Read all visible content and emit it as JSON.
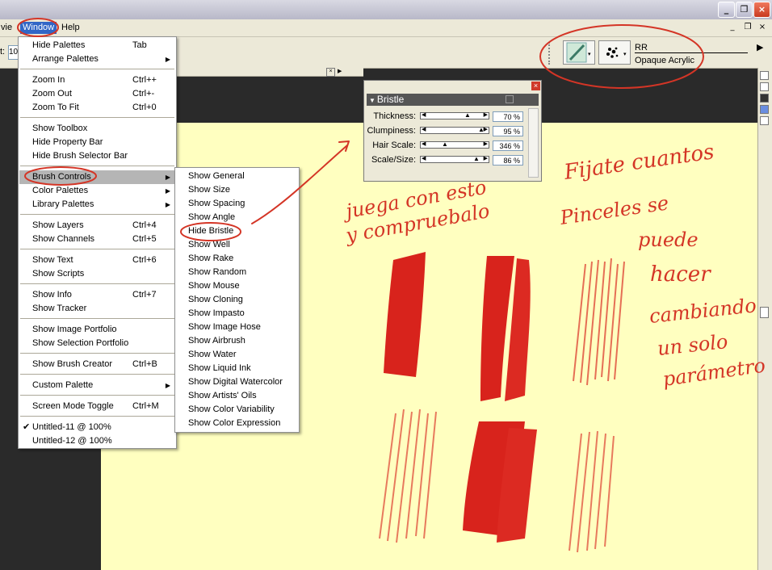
{
  "menubar": {
    "view_partial": "vie",
    "window": "Window",
    "help": "Help",
    "min": "_",
    "restore": "❐",
    "close": "×"
  },
  "propbar": {
    "field_label": "t:",
    "field_value": "10"
  },
  "brush_selector": {
    "category": "RR",
    "variant": "Opaque Acrylic"
  },
  "window_menu": [
    {
      "label": "Hide Palettes",
      "shortcut": "Tab"
    },
    {
      "label": "Arrange Palettes",
      "submenu": true
    },
    {
      "sep": true
    },
    {
      "label": "Zoom In",
      "shortcut": "Ctrl++"
    },
    {
      "label": "Zoom Out",
      "shortcut": "Ctrl+-"
    },
    {
      "label": "Zoom To Fit",
      "shortcut": "Ctrl+0"
    },
    {
      "sep": true
    },
    {
      "label": "Show Toolbox"
    },
    {
      "label": "Hide Property Bar"
    },
    {
      "label": "Hide Brush Selector Bar"
    },
    {
      "sep": true
    },
    {
      "label": "Brush Controls",
      "submenu": true,
      "highlighted": true
    },
    {
      "label": "Color Palettes",
      "submenu": true
    },
    {
      "label": "Library Palettes",
      "submenu": true
    },
    {
      "sep": true
    },
    {
      "label": "Show Layers",
      "shortcut": "Ctrl+4"
    },
    {
      "label": "Show Channels",
      "shortcut": "Ctrl+5"
    },
    {
      "sep": true
    },
    {
      "label": "Show Text",
      "shortcut": "Ctrl+6"
    },
    {
      "label": "Show Scripts"
    },
    {
      "sep": true
    },
    {
      "label": "Show Info",
      "shortcut": "Ctrl+7"
    },
    {
      "label": "Show Tracker"
    },
    {
      "sep": true
    },
    {
      "label": "Show Image Portfolio"
    },
    {
      "label": "Show Selection Portfolio"
    },
    {
      "sep": true
    },
    {
      "label": "Show Brush Creator",
      "shortcut": "Ctrl+B"
    },
    {
      "sep": true
    },
    {
      "label": "Custom Palette",
      "submenu": true
    },
    {
      "sep": true
    },
    {
      "label": "Screen Mode Toggle",
      "shortcut": "Ctrl+M"
    },
    {
      "sep": true
    },
    {
      "label": "Untitled-11 @ 100%",
      "checked": true
    },
    {
      "label": "Untitled-12 @ 100%"
    }
  ],
  "brush_controls_menu": [
    "Show General",
    "Show Size",
    "Show Spacing",
    "Show Angle",
    "Hide Bristle",
    "Show Well",
    "Show Rake",
    "Show Random",
    "Show Mouse",
    "Show Cloning",
    "Show Impasto",
    "Show Image Hose",
    "Show Airbrush",
    "Show Water",
    "Show Liquid Ink",
    "Show Digital Watercolor",
    "Show Artists' Oils",
    "Show Color Variability",
    "Show Color Expression"
  ],
  "bristle_palette": {
    "title": "Bristle",
    "rows": [
      {
        "label": "Thickness:",
        "value": "70 %",
        "level": 0.7
      },
      {
        "label": "Clumpiness:",
        "value": "95 %",
        "level": 0.95
      },
      {
        "label": "Hair Scale:",
        "value": "346 %",
        "level": 0.28
      },
      {
        "label": "Scale/Size:",
        "value": "86 %",
        "level": 0.86
      }
    ]
  },
  "annotations": {
    "note1_line1": "juega con esto",
    "note1_line2": "y compruebalo",
    "note2": [
      "Fijate cuantos",
      "Pinceles se",
      "puede",
      "hacer",
      "cambiando",
      "un solo",
      "parámetro"
    ]
  },
  "colors": {
    "annotation_red": "#d43526",
    "canvas": "#ffffc0",
    "paint_red": "#d8231c",
    "menu_highlight": "#b5b5b5"
  }
}
